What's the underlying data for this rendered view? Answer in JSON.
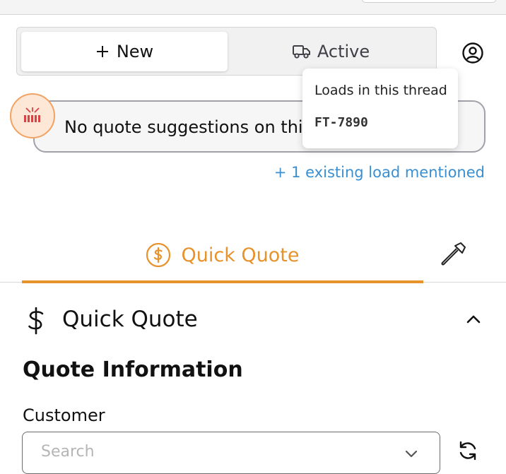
{
  "tabs": {
    "new_label": "New",
    "active_label": "Active"
  },
  "suggestion": {
    "text": "No quote suggestions on this email"
  },
  "tooltip": {
    "title": "Loads in this thread",
    "load_id": "FT-7890"
  },
  "mentioned_link": "+ 1 existing load mentioned",
  "section_tab": {
    "label": "Quick Quote",
    "color": "#e8922b"
  },
  "quick_quote": {
    "title": "Quick Quote",
    "section_heading": "Quote Information",
    "customer_label": "Customer",
    "customer_placeholder": "Search"
  },
  "icons": [
    "plus-icon",
    "truck-icon",
    "user-circle-icon",
    "dollar-circle-icon",
    "hammer-icon",
    "dollar-icon",
    "chevron-up-icon",
    "chevron-down-icon",
    "refresh-icon"
  ]
}
